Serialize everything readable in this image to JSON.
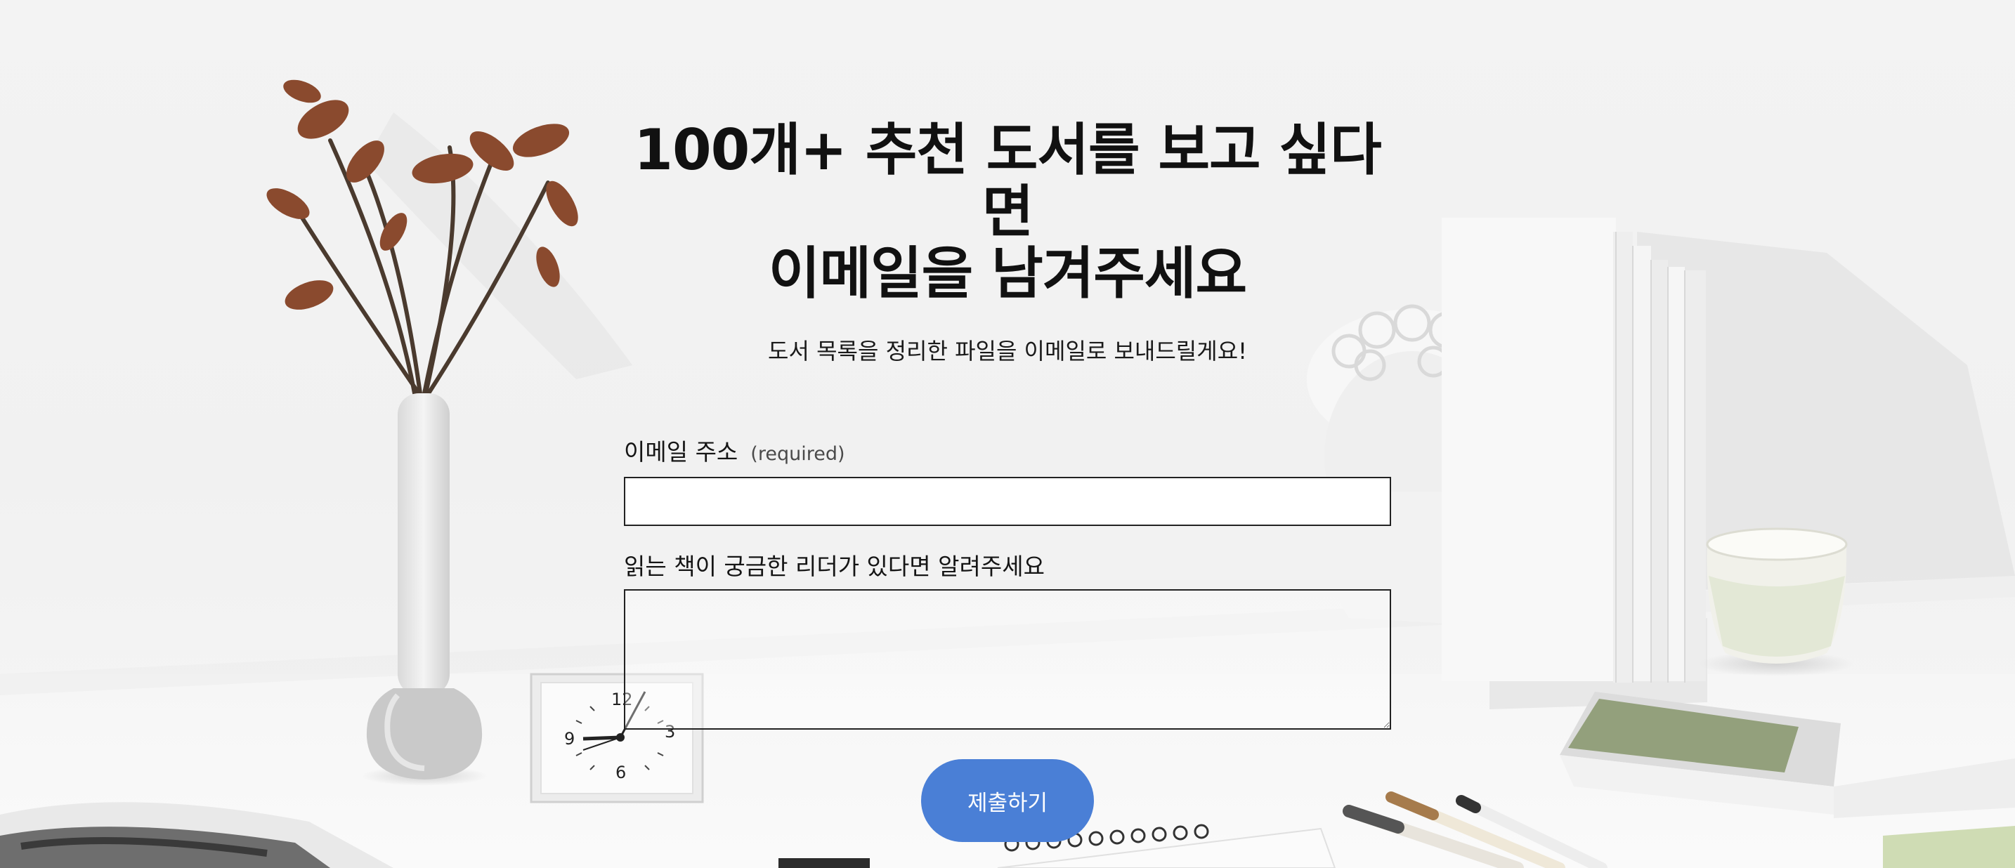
{
  "hero": {
    "title_line1": "100개+ 추천 도서를 보고 싶다면",
    "title_line2": "이메일을 남겨주세요",
    "subtitle": "도서 목록을 정리한 파일을 이메일로 보내드릴게요!"
  },
  "form": {
    "email": {
      "label": "이메일 주소",
      "required_note": "(required)",
      "value": ""
    },
    "question": {
      "label": "읽는 책이 궁금한 리더가 있다면 알려주세요",
      "value": ""
    },
    "submit_label": "제출하기"
  },
  "clock": {
    "numeral_12": "12",
    "numeral_3": "3",
    "numeral_6": "6",
    "numeral_9": "9"
  },
  "colors": {
    "accent": "#4a7fd6",
    "background": "#f3f3f3",
    "text": "#111111"
  }
}
